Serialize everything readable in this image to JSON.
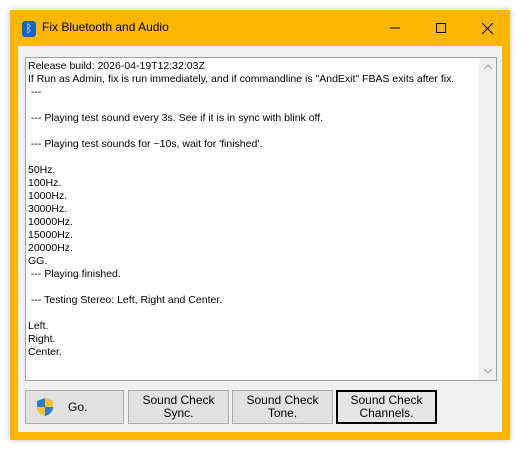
{
  "window": {
    "title": "Fix Bluetooth and Audio",
    "icon": "bluetooth-icon",
    "controls": [
      "minimize-icon",
      "maximize-icon",
      "close-icon"
    ],
    "accent_color": "#fbb503"
  },
  "log": {
    "text": "Release build: 2026-04-19T12:32:03Z\nIf Run as Admin, fix is run immediately, and if commandline is \"AndExit\" FBAS exits after fix.\n ---\n\n --- Playing test sound every 3s. See if it is in sync with blink off.\n\n --- Playing test sounds for ~10s, wait for 'finished'.\n\n50Hz.\n100Hz.\n1000Hz.\n3000Hz.\n10000Hz.\n15000Hz.\n20000Hz.\nGG.\n --- Playing finished.\n\n --- Testing Stereo: Left, Right and Center.\n\nLeft.\nRight.\nCenter."
  },
  "buttons": {
    "go": {
      "label": "Go.",
      "icon": "uac-shield-icon"
    },
    "sync": {
      "label": "Sound Check\nSync."
    },
    "tone": {
      "label": "Sound Check\nTone."
    },
    "channels": {
      "label": "Sound Check\nChannels."
    }
  }
}
